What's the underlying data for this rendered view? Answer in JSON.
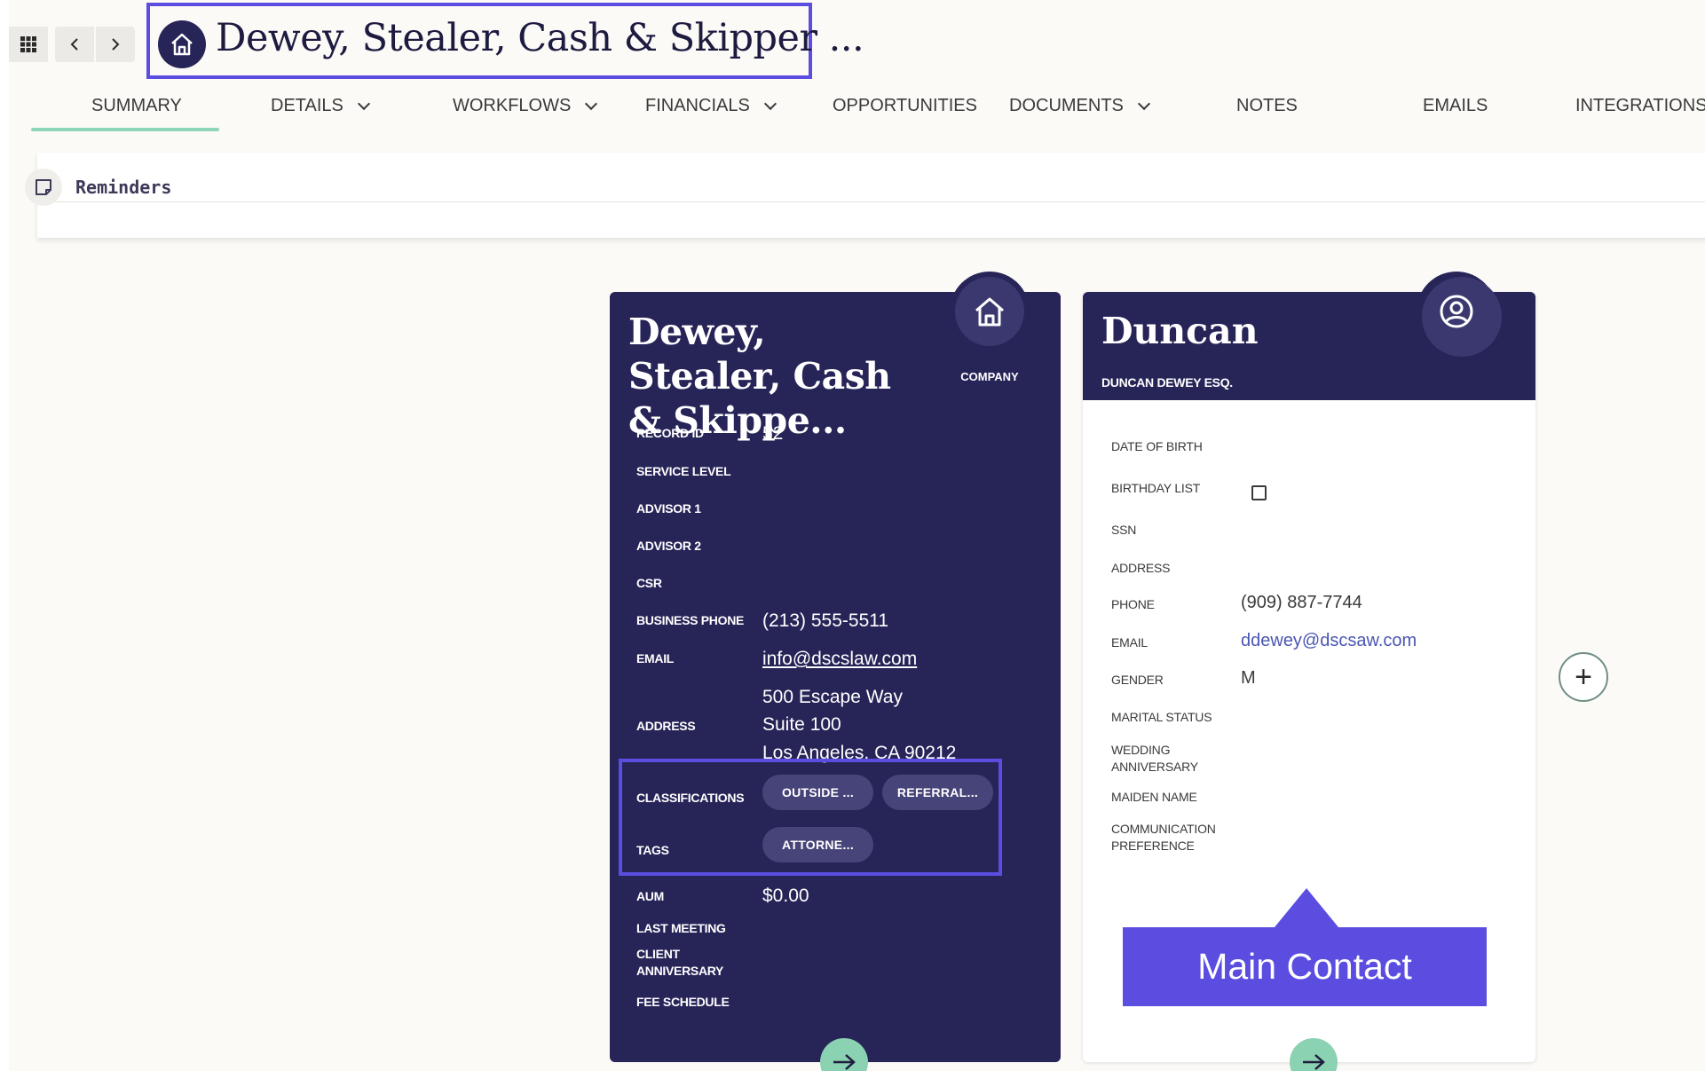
{
  "header": {
    "title": "Dewey, Stealer, Cash & Skipper ..."
  },
  "tabs": [
    {
      "label": "SUMMARY",
      "has_dropdown": false,
      "active": true
    },
    {
      "label": "DETAILS",
      "has_dropdown": true
    },
    {
      "label": "WORKFLOWS",
      "has_dropdown": true
    },
    {
      "label": "FINANCIALS",
      "has_dropdown": true
    },
    {
      "label": "OPPORTUNITIES",
      "has_dropdown": false
    },
    {
      "label": "DOCUMENTS",
      "has_dropdown": true
    },
    {
      "label": "NOTES",
      "has_dropdown": false
    },
    {
      "label": "EMAILS",
      "has_dropdown": false
    },
    {
      "label": "INTEGRATIONS",
      "has_dropdown": true
    }
  ],
  "reminders": {
    "label": "Reminders"
  },
  "company_card": {
    "name": "Dewey, Stealer, Cash & Skippe...",
    "type_label": "COMPANY",
    "fields": {
      "record_id": {
        "label": "RECORD ID",
        "value": "52"
      },
      "service_level": {
        "label": "SERVICE LEVEL",
        "value": ""
      },
      "advisor1": {
        "label": "ADVISOR 1",
        "value": ""
      },
      "advisor2": {
        "label": "ADVISOR 2",
        "value": ""
      },
      "csr": {
        "label": "CSR",
        "value": ""
      },
      "business_phone": {
        "label": "BUSINESS PHONE",
        "value": "(213) 555-5511"
      },
      "email": {
        "label": "EMAIL",
        "value": "info@dscslaw.com"
      },
      "address": {
        "label": "ADDRESS",
        "line1": "500 Escape Way",
        "line2": "Suite 100",
        "line3": "Los Angeles, CA 90212"
      },
      "classifications": {
        "label": "CLASSIFICATIONS",
        "pills": [
          "OUTSIDE ...",
          "REFERRAL..."
        ]
      },
      "tags": {
        "label": "TAGS",
        "pills": [
          "ATTORNE..."
        ]
      },
      "aum": {
        "label": "AUM",
        "value": "$0.00"
      },
      "last_meeting": {
        "label": "LAST MEETING",
        "value": ""
      },
      "client_anniversary": {
        "label": "CLIENT ANNIVERSARY",
        "value": ""
      },
      "fee_schedule": {
        "label": "FEE SCHEDULE",
        "value": ""
      }
    }
  },
  "contact_card": {
    "name": "Duncan",
    "subtitle": "DUNCAN DEWEY ESQ.",
    "fields": {
      "dob": {
        "label": "DATE OF BIRTH",
        "value": ""
      },
      "birthday_list": {
        "label": "BIRTHDAY LIST",
        "checked": false
      },
      "ssn": {
        "label": "SSN",
        "value": ""
      },
      "address": {
        "label": "ADDRESS",
        "value": ""
      },
      "phone": {
        "label": "PHONE",
        "value": "(909) 887-7744"
      },
      "email": {
        "label": "EMAIL",
        "value": "ddewey@dscsaw.com"
      },
      "gender": {
        "label": "GENDER",
        "value": "M"
      },
      "marital_status": {
        "label": "MARITAL STATUS",
        "value": ""
      },
      "wedding_anniversary": {
        "label": "WEDDING ANNIVERSARY",
        "value": ""
      },
      "maiden_name": {
        "label": "MAIDEN NAME",
        "value": ""
      },
      "communication_preference": {
        "label": "COMMUNICATION PREFERENCE",
        "value": ""
      }
    }
  },
  "annotation": {
    "label": "Main Contact"
  },
  "colors": {
    "navy": "#272458",
    "highlight": "#5a4de0",
    "mint": "#8ad2b1",
    "link": "#4a56b3"
  }
}
